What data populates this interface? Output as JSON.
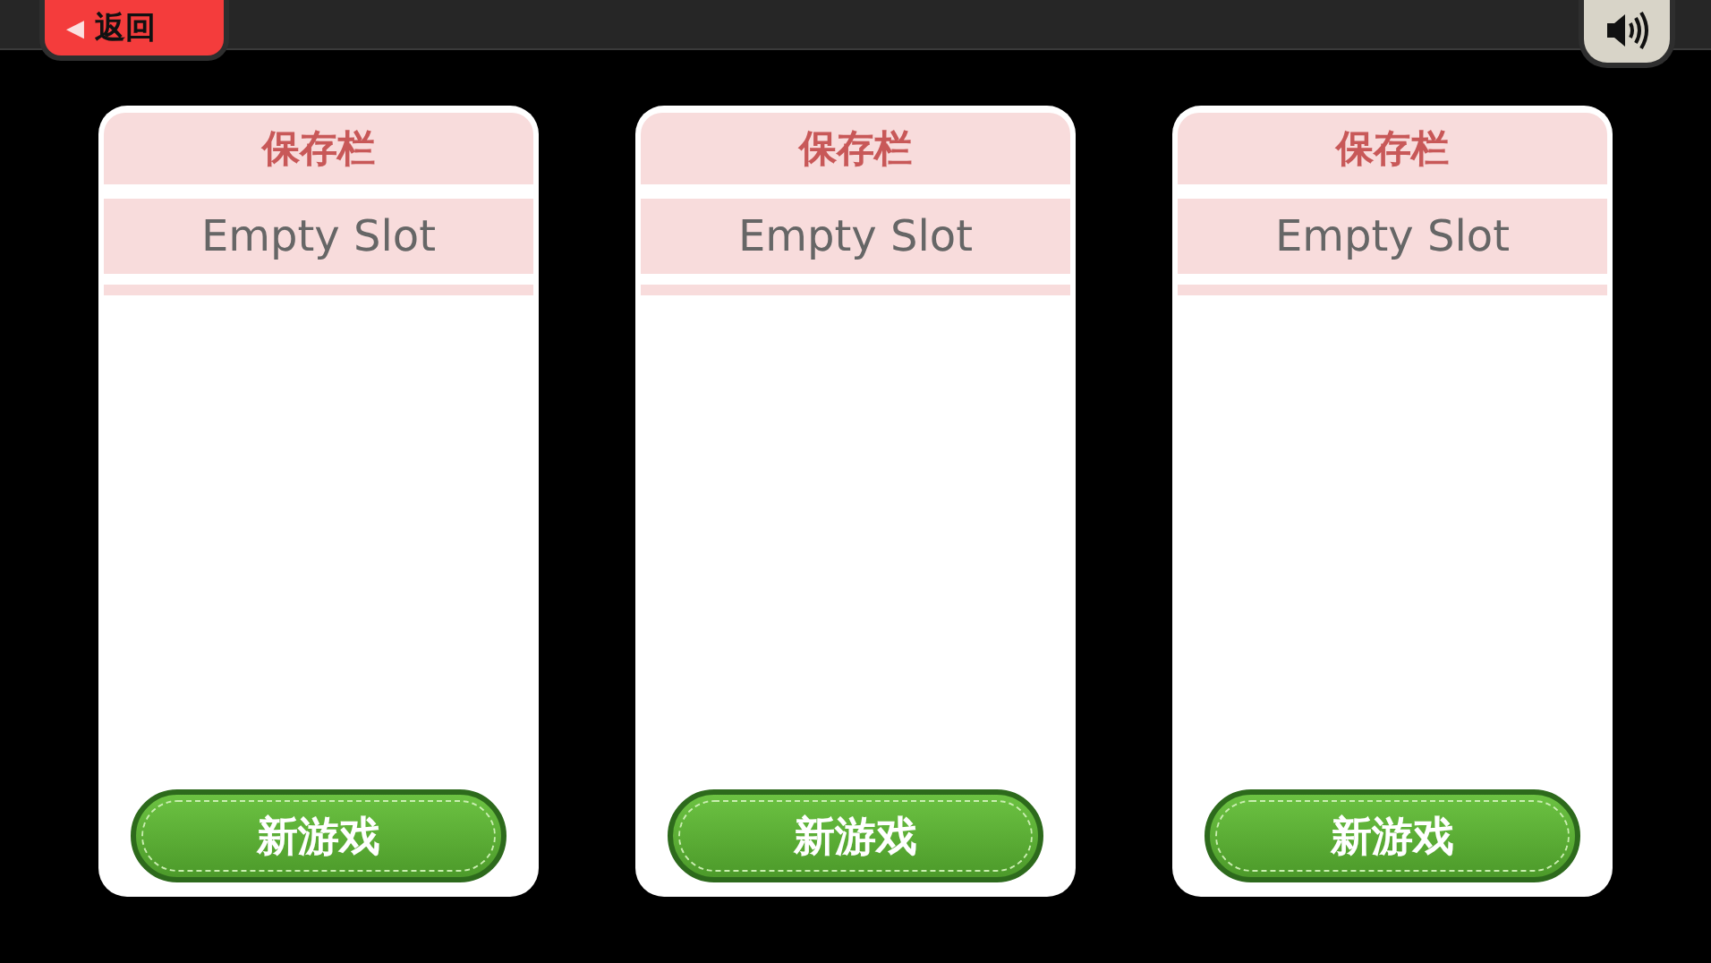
{
  "top_bar": {
    "back_button": {
      "label": "◀",
      "text": "返回"
    }
  },
  "slots": [
    {
      "header": "保存栏",
      "status": "Empty Slot",
      "button": "新游戏"
    },
    {
      "header": "保存栏",
      "status": "Empty Slot",
      "button": "新游戏"
    },
    {
      "header": "保存栏",
      "status": "Empty Slot",
      "button": "新游戏"
    }
  ]
}
